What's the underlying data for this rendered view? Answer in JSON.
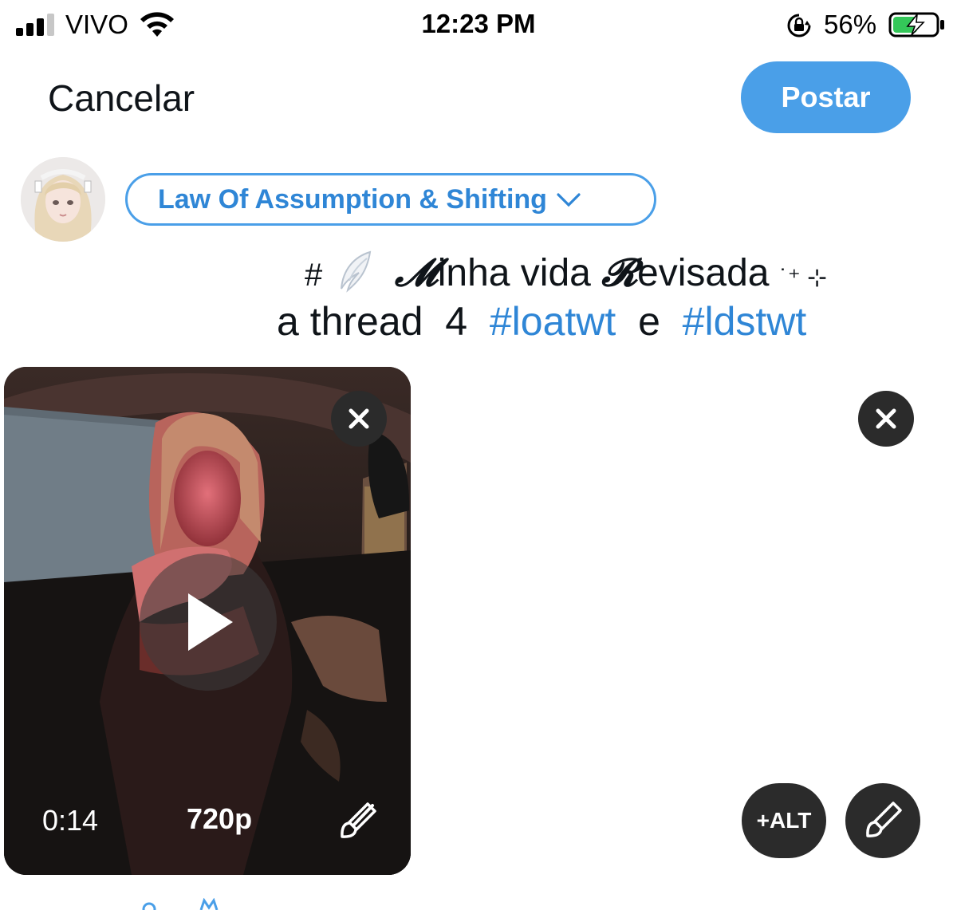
{
  "status_bar": {
    "carrier": "VIVO",
    "time": "12:23 PM",
    "battery_percent": "56%",
    "signal_bars_active": 3,
    "signal_bars_total": 4,
    "battery_level": 0.56,
    "icons": [
      "signal-icon",
      "wifi-icon",
      "rotation-lock-icon",
      "battery-charging-icon"
    ]
  },
  "header": {
    "cancel_label": "Cancelar",
    "post_label": "Postar"
  },
  "composer": {
    "community_label": "Law Of Assumption & Shifting",
    "text": {
      "hash": "#",
      "script_m": "𝓜",
      "part1": "inha vida ",
      "script_r": "𝓡",
      "part2": "evisada",
      "sparkle": "˙⁺ ⊹",
      "line2_prefix": "a thread  4  ",
      "tag1": "#loatwt",
      "joiner": "  e  ",
      "tag2": "#ldstwt"
    }
  },
  "media": {
    "duration": "0:14",
    "quality": "720p",
    "alt_label": "+ALT"
  },
  "colors": {
    "accent": "#4a9fe8",
    "link": "#2f86d6",
    "control_bg": "#2b2b2b"
  }
}
